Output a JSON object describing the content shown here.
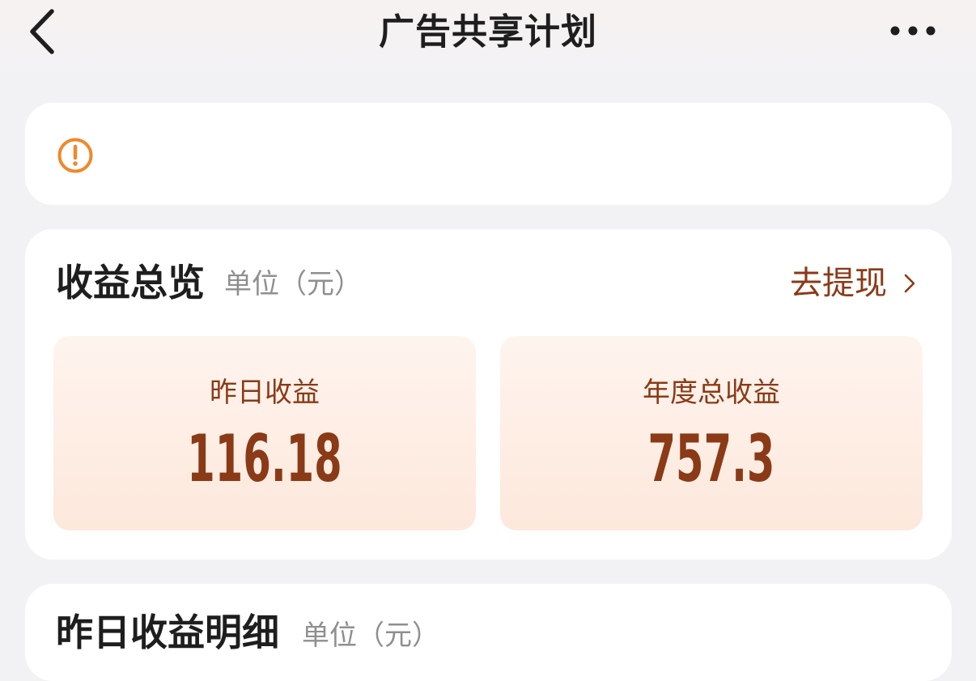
{
  "header": {
    "title": "广告共享计划",
    "back_icon": "chevron-left-icon",
    "more_icon": "more-horizontal-icon"
  },
  "notice": {
    "icon": "warning-circle-icon",
    "icon_color": "#f0882a"
  },
  "overview": {
    "title": "收益总览",
    "unit": "单位（元）",
    "withdraw_label": "去提现",
    "withdraw_icon": "chevron-right-icon",
    "yesterday_label": "昨日收益",
    "yesterday_value": "116.18",
    "yearly_label": "年度总收益",
    "yearly_value": "757.3"
  },
  "detail": {
    "title": "昨日收益明细",
    "unit": "单位（元）"
  },
  "colors": {
    "accent_brown": "#8a3a16",
    "warning_orange": "#f0882a",
    "page_background": "#f2f2f4"
  }
}
